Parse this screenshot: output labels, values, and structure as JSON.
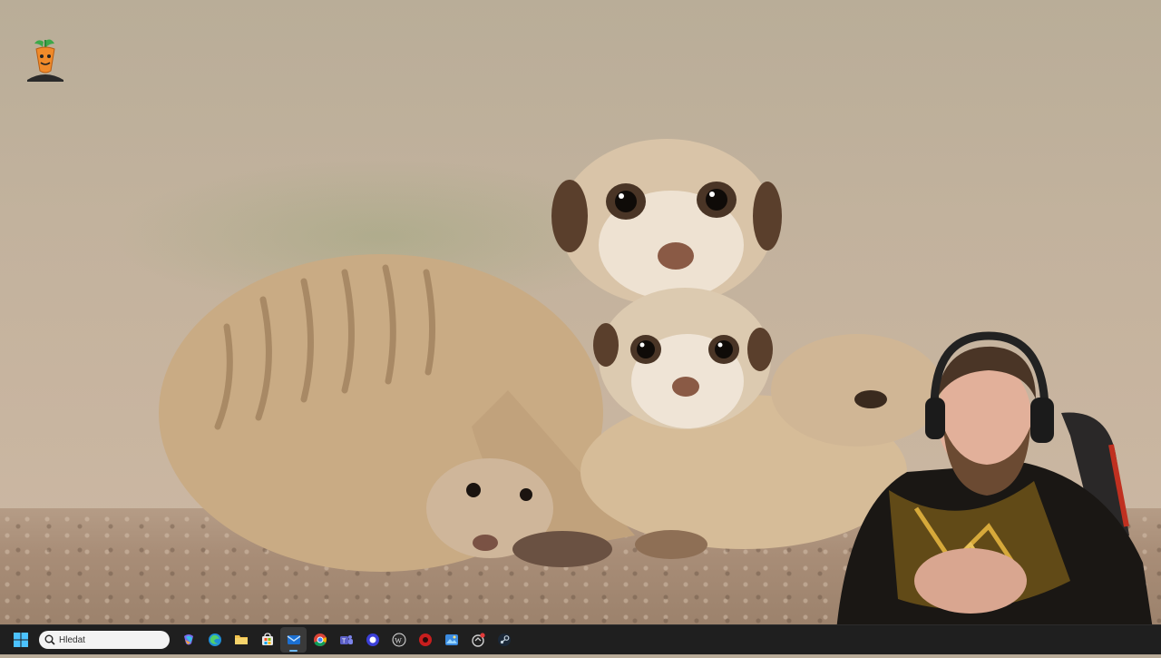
{
  "taskbar": {
    "search_placeholder": "Hledat",
    "apps": [
      {
        "name": "copilot-icon"
      },
      {
        "name": "edge-icon"
      },
      {
        "name": "file-explorer-icon"
      },
      {
        "name": "microsoft-store-icon"
      },
      {
        "name": "mail-icon",
        "active": true
      },
      {
        "name": "chrome-icon"
      },
      {
        "name": "teams-icon"
      },
      {
        "name": "app-circle-icon"
      },
      {
        "name": "wordpress-icon"
      },
      {
        "name": "record-app-icon"
      },
      {
        "name": "photos-icon"
      },
      {
        "name": "app-with-badge-icon"
      },
      {
        "name": "steam-icon"
      }
    ]
  },
  "desktop": {
    "icon_name": "carrot-character-icon"
  },
  "colors": {
    "taskbar_bg": "#1f1f1f",
    "accent": "#6cb8f6"
  }
}
